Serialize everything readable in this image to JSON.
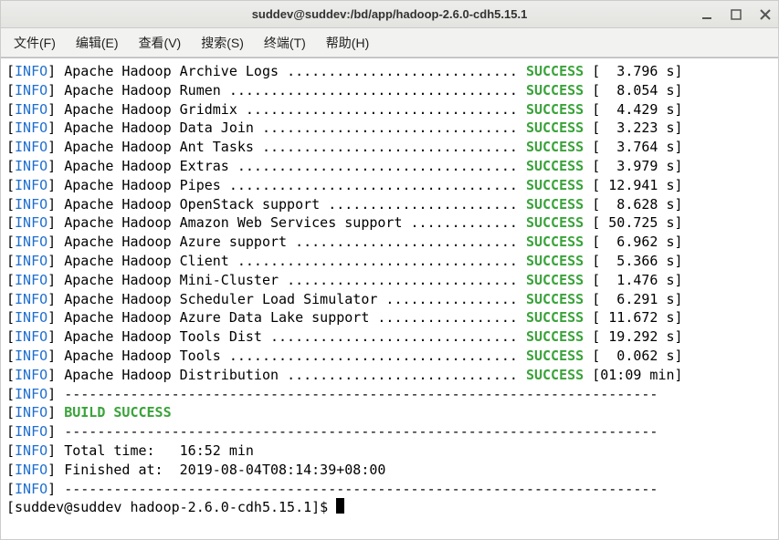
{
  "window": {
    "title": "suddev@suddev:/bd/app/hadoop-2.6.0-cdh5.15.1"
  },
  "menu": {
    "file": "文件(F)",
    "edit": "编辑(E)",
    "view": "查看(V)",
    "search": "搜索(S)",
    "term": "终端(T)",
    "help": "帮助(H)"
  },
  "loglevel": "INFO",
  "modules": [
    {
      "name": "Apache Hadoop Archive Logs",
      "status": "SUCCESS",
      "time": "[  3.796 s]"
    },
    {
      "name": "Apache Hadoop Rumen",
      "status": "SUCCESS",
      "time": "[  8.054 s]"
    },
    {
      "name": "Apache Hadoop Gridmix",
      "status": "SUCCESS",
      "time": "[  4.429 s]"
    },
    {
      "name": "Apache Hadoop Data Join",
      "status": "SUCCESS",
      "time": "[  3.223 s]"
    },
    {
      "name": "Apache Hadoop Ant Tasks",
      "status": "SUCCESS",
      "time": "[  3.764 s]"
    },
    {
      "name": "Apache Hadoop Extras",
      "status": "SUCCESS",
      "time": "[  3.979 s]"
    },
    {
      "name": "Apache Hadoop Pipes",
      "status": "SUCCESS",
      "time": "[ 12.941 s]"
    },
    {
      "name": "Apache Hadoop OpenStack support",
      "status": "SUCCESS",
      "time": "[  8.628 s]"
    },
    {
      "name": "Apache Hadoop Amazon Web Services support",
      "status": "SUCCESS",
      "time": "[ 50.725 s]"
    },
    {
      "name": "Apache Hadoop Azure support",
      "status": "SUCCESS",
      "time": "[  6.962 s]"
    },
    {
      "name": "Apache Hadoop Client",
      "status": "SUCCESS",
      "time": "[  5.366 s]"
    },
    {
      "name": "Apache Hadoop Mini-Cluster",
      "status": "SUCCESS",
      "time": "[  1.476 s]"
    },
    {
      "name": "Apache Hadoop Scheduler Load Simulator",
      "status": "SUCCESS",
      "time": "[  6.291 s]"
    },
    {
      "name": "Apache Hadoop Azure Data Lake support",
      "status": "SUCCESS",
      "time": "[ 11.672 s]"
    },
    {
      "name": "Apache Hadoop Tools Dist",
      "status": "SUCCESS",
      "time": "[ 19.292 s]"
    },
    {
      "name": "Apache Hadoop Tools",
      "status": "SUCCESS",
      "time": "[  0.062 s]"
    },
    {
      "name": "Apache Hadoop Distribution",
      "status": "SUCCESS",
      "time": "[01:09 min]"
    }
  ],
  "dashline": "------------------------------------------------------------------------",
  "build_success": "BUILD SUCCESS",
  "total_time_label": "Total time:",
  "total_time_value": "16:52 min",
  "finished_label": "Finished at:",
  "finished_value": "2019-08-04T08:14:39+08:00",
  "prompt": "[suddev@suddev hadoop-2.6.0-cdh5.15.1]$ "
}
